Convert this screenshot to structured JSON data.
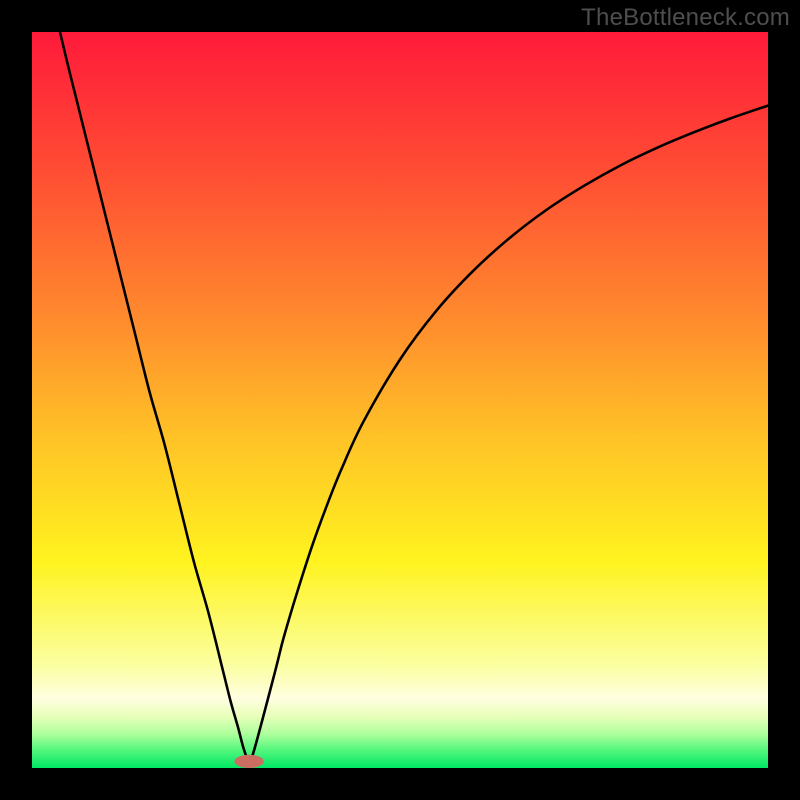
{
  "watermark": {
    "text": "TheBottleneck.com"
  },
  "chart_data": {
    "type": "line",
    "title": "",
    "xlabel": "",
    "ylabel": "",
    "xlim": [
      0,
      100
    ],
    "ylim": [
      0,
      100
    ],
    "grid": false,
    "series": [
      {
        "name": "curve",
        "x": [
          3.8,
          5,
          6,
          8,
          10,
          12,
          14,
          16,
          18,
          20,
          22,
          24,
          26,
          27,
          28,
          28.8,
          29.5,
          30.2,
          33,
          34,
          35,
          36,
          38,
          40,
          42,
          45,
          50,
          55,
          60,
          65,
          70,
          75,
          80,
          85,
          90,
          95,
          100
        ],
        "y": [
          100,
          95,
          91,
          83,
          75,
          67,
          59,
          51,
          44,
          36,
          28,
          21,
          13,
          9,
          5.5,
          2.5,
          1,
          2.5,
          13,
          17,
          20.5,
          23.8,
          30,
          35.5,
          40.5,
          47,
          55.5,
          62.2,
          67.6,
          72.1,
          75.9,
          79.1,
          81.9,
          84.3,
          86.4,
          88.3,
          90
        ]
      }
    ],
    "marker": {
      "x": 29.5,
      "rx": 2.0,
      "ry": 0.9,
      "color": "#cc6d62"
    },
    "background_gradient": {
      "stops": [
        {
          "offset": 0.0,
          "color": "#ff1a3a"
        },
        {
          "offset": 0.2,
          "color": "#ff5033"
        },
        {
          "offset": 0.4,
          "color": "#ff8e2d"
        },
        {
          "offset": 0.55,
          "color": "#ffc227"
        },
        {
          "offset": 0.72,
          "color": "#fff31f"
        },
        {
          "offset": 0.86,
          "color": "#fbffa0"
        },
        {
          "offset": 0.905,
          "color": "#fffee0"
        },
        {
          "offset": 0.93,
          "color": "#e8ffba"
        },
        {
          "offset": 0.955,
          "color": "#a9ff9a"
        },
        {
          "offset": 0.975,
          "color": "#56f77e"
        },
        {
          "offset": 1.0,
          "color": "#00e765"
        }
      ]
    }
  }
}
